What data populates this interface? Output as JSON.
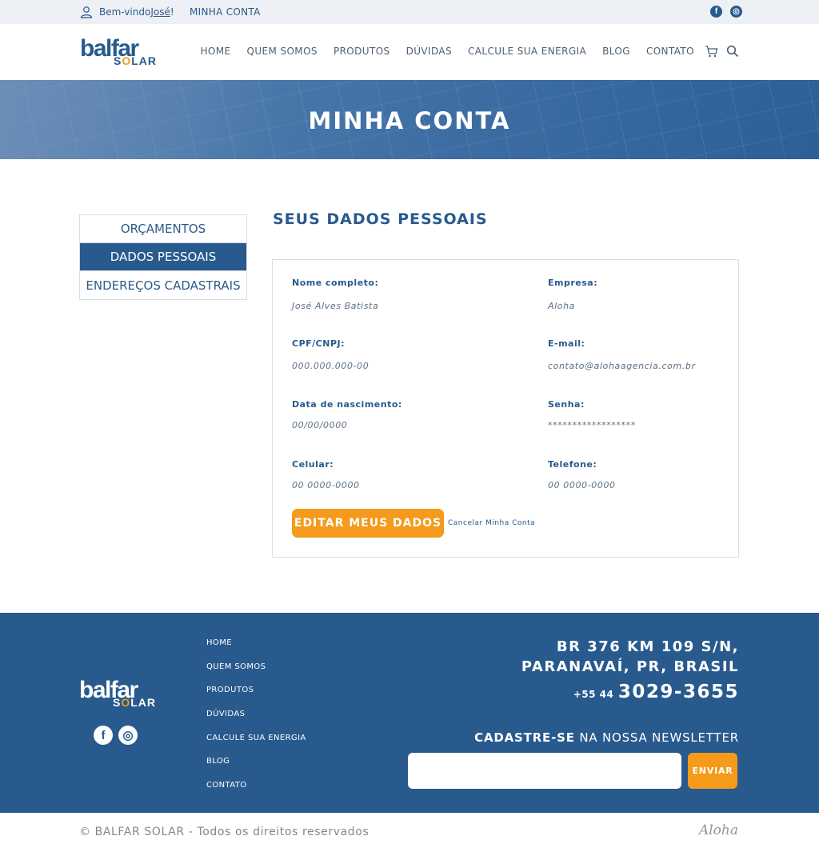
{
  "topbar": {
    "welcome_prefix": "Bem-vindo ",
    "user_name": "José",
    "welcome_suffix": "!",
    "account_link": "MINHA CONTA",
    "social": [
      {
        "icon": "facebook-icon",
        "glyph": "f"
      },
      {
        "icon": "instagram-icon",
        "glyph": "◎"
      }
    ]
  },
  "brand": {
    "logo_top": "balfar",
    "logo_bottom_pre": "S",
    "logo_bottom_o": "O",
    "logo_bottom_post": "LAR",
    "accent": "#f39c12",
    "primary": "#285a8e"
  },
  "nav": {
    "items": [
      "HOME",
      "QUEM SOMOS",
      "PRODUTOS",
      "DÚVIDAS",
      "CALCULE SUA ENERGIA",
      "BLOG",
      "CONTATO"
    ],
    "cart_icon": "cart-icon",
    "search_icon": "search-icon"
  },
  "banner": {
    "title": "MINHA CONTA"
  },
  "sidebar": {
    "items": [
      {
        "label": "ORÇAMENTOS",
        "active": false
      },
      {
        "label": "DADOS PESSOAIS",
        "active": true
      },
      {
        "label": "ENDEREÇOS CADASTRAIS",
        "active": false
      }
    ]
  },
  "main": {
    "title": "SEUS DADOS PESSOAIS",
    "fields": [
      {
        "label": "Nome completo:",
        "value": "José Alves Batista"
      },
      {
        "label": "Empresa:",
        "value": "Aloha"
      },
      {
        "label": "CPF/CNPJ:",
        "value": "000.000.000-00"
      },
      {
        "label": "E-mail:",
        "value": "contato@alohaagencia.com.br"
      },
      {
        "label": "Data de nascimento:",
        "value": "00/00/0000"
      },
      {
        "label": "Senha:",
        "value": "******************"
      },
      {
        "label": "Celular:",
        "value": "00 0000-0000"
      },
      {
        "label": "Telefone:",
        "value": "00 0000-0000"
      }
    ],
    "edit_button": "EDITAR MEUS DADOS",
    "cancel_link": "Cancelar Minha Conta"
  },
  "footer": {
    "nav": [
      "HOME",
      "QUEM SOMOS",
      "PRODUTOS",
      "DÚVIDAS",
      "CALCULE SUA ENERGIA",
      "BLOG",
      "CONTATO"
    ],
    "address_line1": "BR 376 KM 109 S/N,",
    "address_line2": "PARANAVAÍ, PR,  BRASIL",
    "phone_prefix": "+55 44",
    "phone_number": "3029-3655",
    "newsletter_bold": "CADASTRE-SE",
    "newsletter_rest": " NA NOSSA NEWSLETTER",
    "newsletter_placeholder": "",
    "newsletter_button": "ENVIAR",
    "social": [
      {
        "icon": "facebook-icon",
        "glyph": "f"
      },
      {
        "icon": "instagram-icon",
        "glyph": "◎"
      }
    ]
  },
  "bottom": {
    "copyright": "© BALFAR SOLAR - Todos os direitos reservados",
    "agency": "Aloha"
  }
}
